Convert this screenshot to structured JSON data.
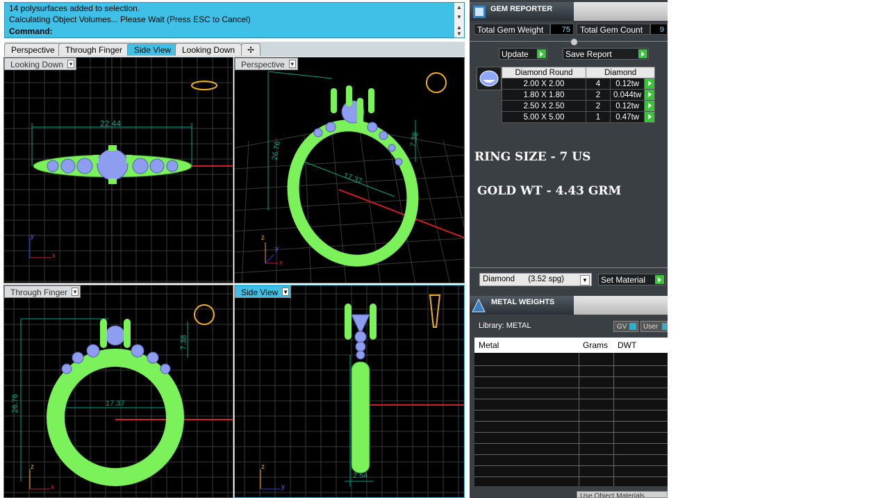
{
  "command": {
    "lines": [
      "14 polysurfaces added to selection.",
      "Calculating Object Volumes... Please Wait (Press ESC to Cancel)"
    ],
    "prompt": "Command:"
  },
  "tabs": [
    {
      "label": "Perspective",
      "active": false
    },
    {
      "label": "Through Finger",
      "active": false
    },
    {
      "label": "Side View",
      "active": true
    },
    {
      "label": "Looking Down",
      "active": false
    }
  ],
  "viewports": {
    "top_left": {
      "label": "Looking Down",
      "dimension": "22.44",
      "axis_v": "y",
      "axis_h": "x"
    },
    "top_right": {
      "label": "Perspective",
      "dim_a": "26.76",
      "dim_b": "7.38",
      "dim_c": "17.37",
      "axis_v": "z",
      "axis_h": "x",
      "axis_d": "y"
    },
    "bottom_left": {
      "label": "Through Finger",
      "dim_height": "26.76",
      "dim_top": "7.38",
      "dim_width": "17.37",
      "axis_v": "z",
      "axis_h": "x"
    },
    "bottom_right": {
      "label": "Side View",
      "dimension": "2.54",
      "axis_v": "z",
      "axis_h": "y"
    }
  },
  "gem_reporter": {
    "title": "GEM REPORTER",
    "total_weight_label": "Total Gem Weight",
    "total_weight_value": "75",
    "total_count_label": "Total Gem Count",
    "total_count_value": "9",
    "update_label": "Update",
    "save_label": "Save Report",
    "table_headers": [
      "Diamond Round",
      "Diamond"
    ],
    "rows": [
      {
        "size": "2.00 X 2.00",
        "count": "4",
        "weight": "0.12tw"
      },
      {
        "size": "1.80 X 1.80",
        "count": "2",
        "weight": "0.044tw"
      },
      {
        "size": "2.50 X 2.50",
        "count": "2",
        "weight": "0.12tw"
      },
      {
        "size": "5.00 X 5.00",
        "count": "1",
        "weight": "0.47tw"
      }
    ],
    "material_select": "Diamond      (3.52 spg)",
    "set_material_label": "Set Material"
  },
  "notes": {
    "ring_size": "RING SIZE - 7 US",
    "gold_weight": "GOLD WT - 4.43 GRM"
  },
  "metal_weights": {
    "title": "METAL WEIGHTS",
    "library": "Library: METAL",
    "gv_label": "GV",
    "user_label": "User",
    "headers": [
      "Metal",
      "Grams",
      "DWT"
    ],
    "footer_button": "Use Object Materials"
  },
  "colors": {
    "accent": "#3fc0e6",
    "ring_green": "#7cf25a",
    "gem_blue": "#8f9df0",
    "dim_line": "#00a88a",
    "axis_red": "#d02020",
    "go_green": "#3cc23c"
  }
}
